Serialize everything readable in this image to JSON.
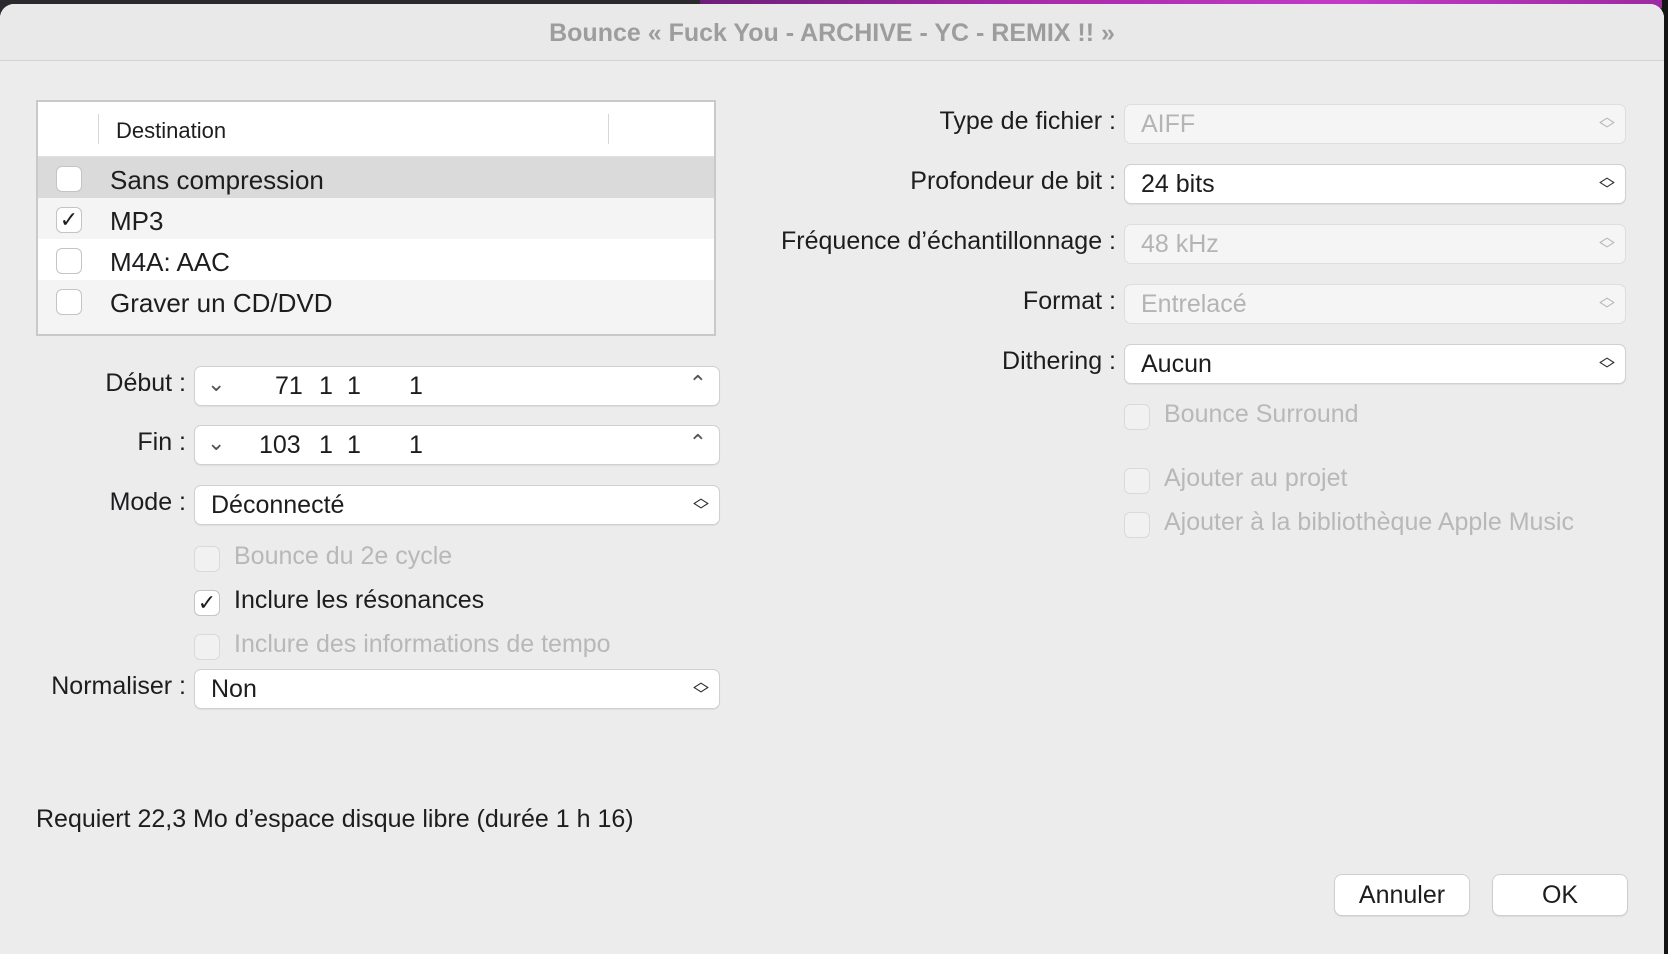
{
  "window": {
    "title": "Bounce « Fuck You - ARCHIVE - YC - REMIX !! »"
  },
  "destinations": {
    "header": "Destination",
    "rows": [
      {
        "label": "Sans compression",
        "checked": false
      },
      {
        "label": "MP3",
        "checked": true
      },
      {
        "label": "M4A: AAC",
        "checked": false
      },
      {
        "label": "Graver un CD/DVD",
        "checked": false
      }
    ]
  },
  "range": {
    "start_label": "Début :",
    "start": {
      "bar": "71",
      "beat": "1",
      "div": "1",
      "tick": "1"
    },
    "end_label": "Fin :",
    "end": {
      "bar": "103",
      "beat": "1",
      "div": "1",
      "tick": "1"
    }
  },
  "mode": {
    "label": "Mode :",
    "value": "Déconnecté"
  },
  "options": {
    "second_cycle": {
      "label": "Bounce du 2e cycle",
      "checked": false,
      "enabled": false
    },
    "include_tails": {
      "label": "Inclure les résonances",
      "checked": true,
      "enabled": true
    },
    "include_tempo": {
      "label": "Inclure des informations de tempo",
      "checked": false,
      "enabled": false
    }
  },
  "normalize": {
    "label": "Normaliser :",
    "value": "Non"
  },
  "file_settings": {
    "file_type": {
      "label": "Type de fichier :",
      "value": "AIFF",
      "enabled": false
    },
    "bit_depth": {
      "label": "Profondeur de bit :",
      "value": "24 bits",
      "enabled": true
    },
    "sample_rate": {
      "label": "Fréquence d’échantillonnage :",
      "value": "48 kHz",
      "enabled": false
    },
    "format": {
      "label": "Format :",
      "value": "Entrelacé",
      "enabled": false
    },
    "dithering": {
      "label": "Dithering :",
      "value": "Aucun",
      "enabled": true
    }
  },
  "right_options": {
    "bounce_surround": {
      "label": "Bounce Surround",
      "checked": false,
      "enabled": false
    },
    "add_to_project": {
      "label": "Ajouter au projet",
      "checked": false,
      "enabled": false
    },
    "add_to_music": {
      "label": "Ajouter à la bibliothèque Apple Music",
      "checked": false,
      "enabled": false
    }
  },
  "footer": {
    "disk_space": "Requiert 22,3 Mo d’espace disque libre (durée 1 h 16)",
    "cancel": "Annuler",
    "ok": "OK"
  }
}
